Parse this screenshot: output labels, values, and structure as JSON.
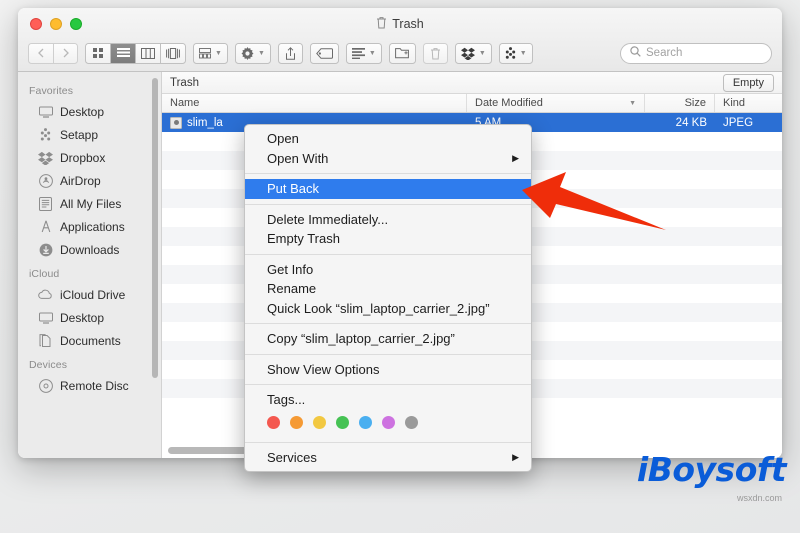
{
  "window": {
    "title": "Trash",
    "title_icon": "trash-icon",
    "lights": [
      "close",
      "minimize",
      "zoom"
    ]
  },
  "toolbar": {
    "back_icon": "chevron-left-icon",
    "forward_icon": "chevron-right-icon",
    "views": [
      {
        "name": "icon-view",
        "icon": "grid-icon",
        "active": false
      },
      {
        "name": "list-view",
        "icon": "list-icon",
        "active": true
      },
      {
        "name": "column-view",
        "icon": "columns-icon",
        "active": false
      },
      {
        "name": "gallery-view",
        "icon": "gallery-icon",
        "active": false
      }
    ],
    "group_icon": "group-by-icon",
    "action_icon": "gear-icon",
    "share_icon": "share-icon",
    "tag_icon": "tag-icon",
    "arrange_icon": "arrange-icon",
    "newfolder_icon": "new-folder-icon",
    "delete_icon": "trash-icon",
    "dropbox_icon": "dropbox-icon",
    "setapp_icon": "setapp-icon",
    "search_placeholder": "Search",
    "search_value": "",
    "search_icon": "search-icon"
  },
  "sidebar": {
    "sections": [
      {
        "title": "Favorites",
        "items": [
          {
            "label": "Desktop",
            "icon": "desktop-icon"
          },
          {
            "label": "Setapp",
            "icon": "setapp-icon"
          },
          {
            "label": "Dropbox",
            "icon": "dropbox-icon"
          },
          {
            "label": "AirDrop",
            "icon": "airdrop-icon"
          },
          {
            "label": "All My Files",
            "icon": "all-my-files-icon"
          },
          {
            "label": "Applications",
            "icon": "applications-icon"
          },
          {
            "label": "Downloads",
            "icon": "downloads-icon"
          }
        ]
      },
      {
        "title": "iCloud",
        "items": [
          {
            "label": "iCloud Drive",
            "icon": "cloud-icon"
          },
          {
            "label": "Desktop",
            "icon": "desktop-icon"
          },
          {
            "label": "Documents",
            "icon": "documents-icon"
          }
        ]
      },
      {
        "title": "Devices",
        "items": [
          {
            "label": "Remote Disc",
            "icon": "disc-icon"
          }
        ]
      }
    ]
  },
  "content": {
    "breadcrumb": "Trash",
    "empty_button": "Empty",
    "columns": [
      "Name",
      "Date Modified",
      "Size",
      "Kind"
    ],
    "sort_caret_icon": "chevron-down-icon",
    "rows": [
      {
        "name": "slim_la",
        "date": "5 AM",
        "size": "24 KB",
        "kind": "JPEG",
        "selected": true,
        "icon": "jpeg-file-icon"
      }
    ],
    "empty_row_count": 15
  },
  "context_menu": {
    "groups": [
      [
        {
          "label": "Open",
          "submenu": false,
          "highlighted": false
        },
        {
          "label": "Open With",
          "submenu": true,
          "highlighted": false
        }
      ],
      [
        {
          "label": "Put Back",
          "submenu": false,
          "highlighted": true
        }
      ],
      [
        {
          "label": "Delete Immediately...",
          "submenu": false,
          "highlighted": false
        },
        {
          "label": "Empty Trash",
          "submenu": false,
          "highlighted": false
        }
      ],
      [
        {
          "label": "Get Info",
          "submenu": false,
          "highlighted": false
        },
        {
          "label": "Rename",
          "submenu": false,
          "highlighted": false
        },
        {
          "label": "Quick Look “slim_laptop_carrier_2.jpg”",
          "submenu": false,
          "highlighted": false
        }
      ],
      [
        {
          "label": "Copy “slim_laptop_carrier_2.jpg”",
          "submenu": false,
          "highlighted": false
        }
      ],
      [
        {
          "label": "Show View Options",
          "submenu": false,
          "highlighted": false
        }
      ],
      [
        {
          "label": "Tags...",
          "submenu": false,
          "highlighted": false
        }
      ],
      [
        {
          "label": "Services",
          "submenu": true,
          "highlighted": false
        }
      ]
    ],
    "tag_colors": [
      "#f4584f",
      "#f59a34",
      "#f2c841",
      "#46c254",
      "#4aaff0",
      "#cd72e0",
      "#9a9a9a"
    ],
    "submenu_glyph": "▶"
  },
  "annotation": {
    "arrow_color": "#ef2d0a",
    "arrow_points_to": "Put Back"
  },
  "watermark": {
    "logo": "iBoysoft",
    "source": "wsxdn.com",
    "color": "#0a5cd8"
  }
}
